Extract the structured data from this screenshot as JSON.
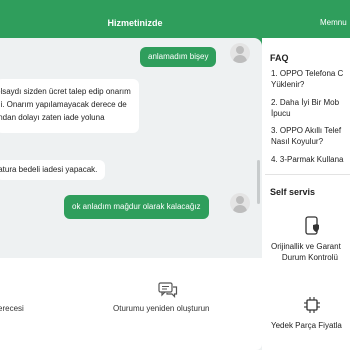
{
  "header": {
    "title": "Hizmetinizde",
    "right_text": "Memnu"
  },
  "chat": {
    "messages": [
      {
        "from": "user",
        "text": "anlamadım bişey"
      },
      {
        "from": "bot",
        "lines": [
          "olsaydı sizden ücret talep edip onarım",
          "di. Onarım yapılamayacak derece de",
          "ından dolayı zaten iade yoluna"
        ]
      },
      {
        "from": "bot",
        "lines": [
          "fatura bedeli iadesi yapacak."
        ]
      },
      {
        "from": "user",
        "text": "ok anladım mağdur olarak kalacağız"
      }
    ]
  },
  "actions": {
    "left_label": "erecesi",
    "restart_label": "Oturumu yeniden oluşturun",
    "restart_icon": "chat-bubbles-icon"
  },
  "sidebar": {
    "faq_title": "FAQ",
    "faq_items": [
      [
        "1. OPPO Telefona C",
        "Yüklenir?"
      ],
      [
        "2. Daha İyi Bir Mob",
        "İpucu"
      ],
      [
        "3. OPPO Akıllı Telef",
        "Nasıl Koyulur?"
      ],
      [
        "4. 3-Parmak Kullana"
      ]
    ],
    "self_service_title": "Self servis",
    "services": [
      {
        "lines": [
          "Orijinallik ve Garant",
          "Durum Kontrolü"
        ],
        "icon": "phone-shield-icon"
      },
      {
        "lines": [
          "Yedek Parça Fiyatla"
        ],
        "icon": "chip-icon"
      }
    ]
  },
  "colors": {
    "brand_green": "#2f9e5c",
    "chat_background": "#eef1f2"
  }
}
